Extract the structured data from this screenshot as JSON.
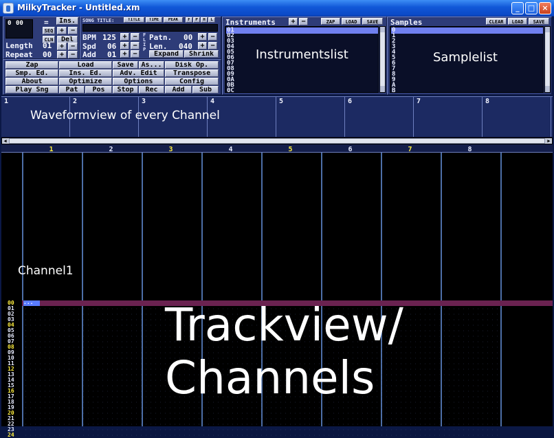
{
  "window": {
    "title": "MilkyTracker - Untitled.xm",
    "buttons": {
      "minimize": "_",
      "maximize": "□",
      "close": "×"
    }
  },
  "song_panel": {
    "pos_values": [
      "0",
      "00"
    ],
    "ins_label": "Ins.",
    "seq_label": "SEQ",
    "cln_label": "CLN",
    "del_label": "Del",
    "plus": "+",
    "minus": "−",
    "eq": "=",
    "length_label": "Length",
    "length_value": "01",
    "repeat_label": "Repeat",
    "repeat_value": "00",
    "song_title_label": "SONG TITLE:",
    "title_label": "TITLE",
    "time_label": "TIME",
    "peak_label": "PEAK",
    "flags": [
      "F",
      "P",
      "H",
      "L"
    ],
    "bpm_label": "BPM",
    "bpm_value": "125",
    "spd_label": "Spd",
    "spd_value": "06",
    "add_label": "Add",
    "add_value": "01",
    "patn_label": "Patn.",
    "patn_value": "00",
    "len_label": "Len.",
    "len_value": "040",
    "flip_label": "FLIP",
    "expand_label": "Expand",
    "shrink_label": "Shrink"
  },
  "main_buttons": [
    [
      "Zap",
      "Load",
      "Save",
      "As...",
      "Disk Op."
    ],
    [
      "Smp. Ed.",
      "Ins. Ed.",
      "Adv. Edit",
      "Transpose"
    ],
    [
      "About",
      "Optimize",
      "Options",
      "Config"
    ],
    [
      "Play Sng",
      "Pat",
      "Pos",
      "Stop",
      "Rec",
      "Add",
      "Sub"
    ]
  ],
  "instruments": {
    "title": "Instruments",
    "plus": "+",
    "minus": "−",
    "buttons": [
      "ZAP",
      "LOAD",
      "SAVE"
    ],
    "numbers": [
      "01",
      "02",
      "03",
      "04",
      "05",
      "06",
      "07",
      "08",
      "09",
      "0A",
      "0B",
      "0C"
    ],
    "overlay_label": "Instrumentslist"
  },
  "samples": {
    "title": "Samples",
    "buttons": [
      "CLEAR",
      "LOAD",
      "SAVE"
    ],
    "numbers": [
      "0",
      "1",
      "2",
      "3",
      "4",
      "5",
      "6",
      "7",
      "8",
      "9",
      "A",
      "B"
    ],
    "overlay_label": "Samplelist"
  },
  "scopes": {
    "channels": [
      "1",
      "2",
      "3",
      "4",
      "5",
      "6",
      "7",
      "8"
    ],
    "overlay_label": "Waveformview of every Channel"
  },
  "pattern": {
    "channels": [
      "1",
      "2",
      "3",
      "4",
      "5",
      "6",
      "7",
      "8"
    ],
    "channel_label": "Channel1",
    "overlay_label_1": "Trackview/",
    "overlay_label_2": "Channels",
    "cursor_text": "...",
    "row_numbers": [
      "00",
      "01",
      "02",
      "03",
      "04",
      "05",
      "06",
      "07",
      "08",
      "09",
      "10",
      "11",
      "12",
      "13",
      "14",
      "15",
      "16",
      "17",
      "18",
      "19",
      "20",
      "21",
      "22",
      "23",
      "24"
    ],
    "highlight_rows": [
      "00",
      "04",
      "08",
      "12",
      "16",
      "20",
      "24"
    ]
  },
  "colors": {
    "highlight": "#ffef40",
    "current_row": "#6a2250",
    "cursor": "#5a7cff",
    "bg": "#0b1845"
  }
}
